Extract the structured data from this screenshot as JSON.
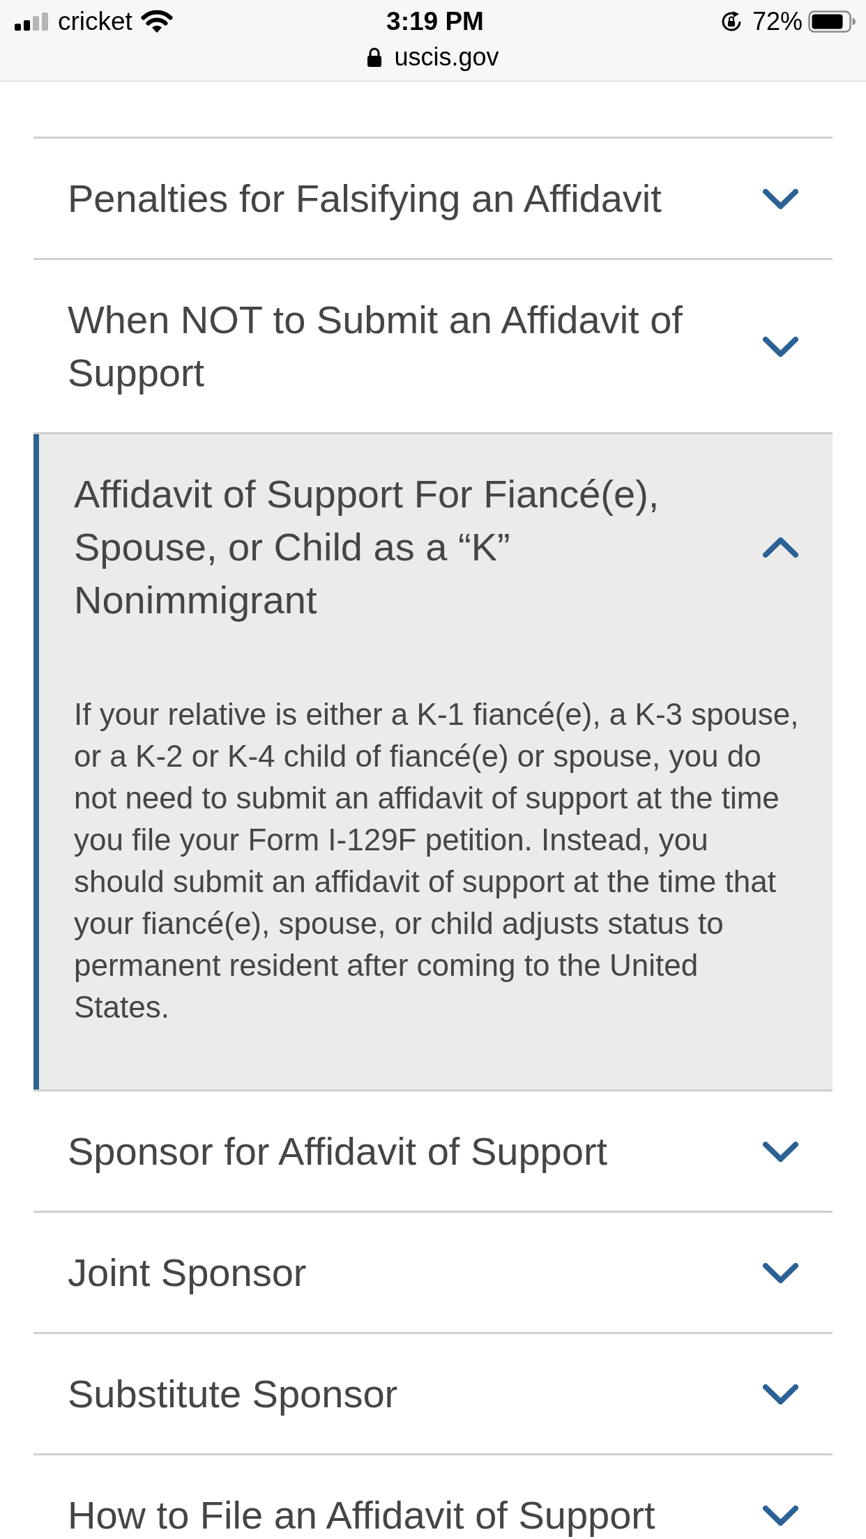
{
  "status_bar": {
    "carrier": "cricket",
    "time": "3:19 PM",
    "url": "uscis.gov",
    "battery": "72%"
  },
  "accordion": [
    {
      "title": "Penalties for Falsifying an Affidavit",
      "expanded": false
    },
    {
      "title": "When NOT to Submit an Affidavit of Support",
      "expanded": false
    },
    {
      "title": "Affidavit of Support For Fiancé(e), Spouse, or Child as a “K” Nonimmigrant",
      "expanded": true,
      "body": "If your relative is either a K-1 fiancé(e), a K-3 spouse, or a K-2 or K-4 child of fiancé(e) or spouse, you do not need to submit an affidavit of support at the time you file your Form I-129F petition. Instead, you should submit an affidavit of support at the time that your fiancé(e), spouse, or child adjusts status to permanent resident after coming to the United States."
    },
    {
      "title": "Sponsor for Affidavit of Support",
      "expanded": false
    },
    {
      "title": "Joint Sponsor",
      "expanded": false
    },
    {
      "title": "Substitute Sponsor",
      "expanded": false
    },
    {
      "title": "How to File an Affidavit of Support",
      "expanded": false
    }
  ]
}
